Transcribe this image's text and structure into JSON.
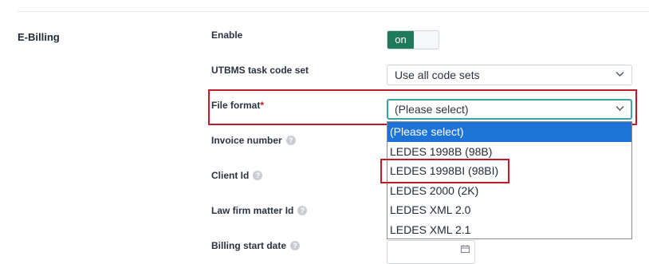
{
  "section": {
    "title": "E-Billing"
  },
  "fields": {
    "enable": {
      "label": "Enable",
      "toggle_value": "on"
    },
    "utbms": {
      "label": "UTBMS task code set",
      "value": "Use all code sets"
    },
    "file_format": {
      "label": "File format",
      "required_mark": "*",
      "value": "(Please select)"
    },
    "invoice_number": {
      "label": "Invoice number",
      "help": "?"
    },
    "client_id": {
      "label": "Client Id",
      "help": "?"
    },
    "law_firm_matter_id": {
      "label": "Law firm matter Id",
      "help": "?"
    },
    "billing_start_date": {
      "label": "Billing start date",
      "help": "?"
    }
  },
  "dropdown": {
    "options": [
      "(Please select)",
      "LEDES 1998B (98B)",
      "LEDES 1998BI (98BI)",
      "LEDES 2000 (2K)",
      "LEDES XML 2.0",
      "LEDES XML 2.1"
    ],
    "selected": "(Please select)",
    "highlighted": "LEDES 1998BI (98BI)"
  },
  "colors": {
    "toggle_on": "#1f7a5c",
    "selected_option": "#1e74d6",
    "annotation_box": "#c0192a",
    "focus_border": "#3aa3a6"
  },
  "icons": [
    "chevron-down-icon",
    "help-icon",
    "calendar-icon"
  ]
}
